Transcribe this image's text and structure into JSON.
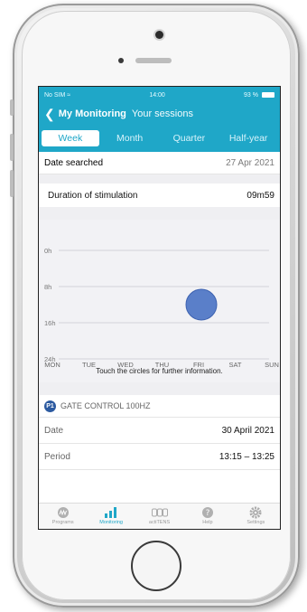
{
  "status_bar": {
    "carrier": "No SIM",
    "time": "14:00",
    "battery": "93 %"
  },
  "nav": {
    "back_label": "My Monitoring",
    "subtitle": "Your sessions"
  },
  "tabs": [
    {
      "label": "Week",
      "active": true
    },
    {
      "label": "Month",
      "active": false
    },
    {
      "label": "Quarter",
      "active": false
    },
    {
      "label": "Half-year",
      "active": false
    }
  ],
  "date_searched": {
    "label": "Date searched",
    "value": "27 Apr 2021"
  },
  "duration": {
    "label": "Duration of stimulation",
    "value": "09m59"
  },
  "chart_data": {
    "type": "scatter",
    "categories": [
      "MON",
      "TUE",
      "WED",
      "THU",
      "FRI",
      "SAT",
      "SUN"
    ],
    "y_ticks": [
      "0h",
      "8h",
      "16h",
      "24h"
    ],
    "ylim": [
      0,
      24
    ],
    "points": [
      {
        "day": "FRI",
        "hour": 12
      }
    ],
    "grid": true
  },
  "chart_hint": "Touch the circles for further information.",
  "program": {
    "badge": "P1",
    "name": "GATE CONTROL 100HZ"
  },
  "session_rows": [
    {
      "key": "Date",
      "value": "30 April 2021"
    },
    {
      "key": "Period",
      "value": "13:15 – 13:25"
    }
  ],
  "tabbar": [
    {
      "label": "Programs",
      "icon": "programs-icon",
      "active": false
    },
    {
      "label": "Monitoring",
      "icon": "bar-chart-icon",
      "active": true
    },
    {
      "label": "actiTENS",
      "icon": "device-icon",
      "active": false
    },
    {
      "label": "Help",
      "icon": "help-icon",
      "active": false
    },
    {
      "label": "Settings",
      "icon": "gear-icon",
      "active": false
    }
  ],
  "colors": {
    "accent": "#1fa7c8",
    "point": "#5a7fc9",
    "badge": "#2c5aa0"
  }
}
